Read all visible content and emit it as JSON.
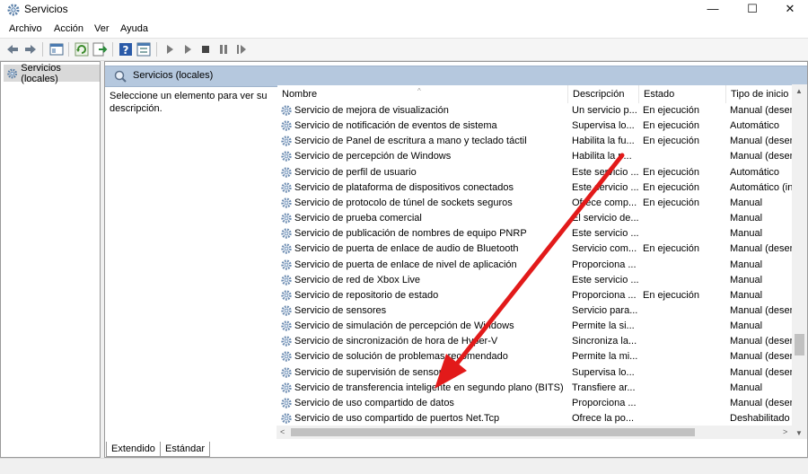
{
  "window": {
    "title": "Servicios"
  },
  "menu": [
    "Archivo",
    "Acción",
    "Ver",
    "Ayuda"
  ],
  "tree": {
    "root": "Servicios (locales)"
  },
  "pane": {
    "header": "Servicios (locales)",
    "description_prompt": "Seleccione un elemento para ver su descripción."
  },
  "columns": [
    "Nombre",
    "Descripción",
    "Estado",
    "Tipo de inicio"
  ],
  "rows": [
    {
      "name": "Servicio de mejora de visualización",
      "desc": "Un servicio p...",
      "state": "En ejecución",
      "start": "Manual (desen..."
    },
    {
      "name": "Servicio de notificación de eventos de sistema",
      "desc": "Supervisa lo...",
      "state": "En ejecución",
      "start": "Automático"
    },
    {
      "name": "Servicio de Panel de escritura a mano y teclado táctil",
      "desc": "Habilita la fu...",
      "state": "En ejecución",
      "start": "Manual (desen..."
    },
    {
      "name": "Servicio de percepción de Windows",
      "desc": "Habilita la p...",
      "state": "",
      "start": "Manual (desen..."
    },
    {
      "name": "Servicio de perfil de usuario",
      "desc": "Este servicio ...",
      "state": "En ejecución",
      "start": "Automático"
    },
    {
      "name": "Servicio de plataforma de dispositivos conectados",
      "desc": "Este servicio ...",
      "state": "En ejecución",
      "start": "Automático (in..."
    },
    {
      "name": "Servicio de protocolo de túnel de sockets seguros",
      "desc": "Ofrece comp...",
      "state": "En ejecución",
      "start": "Manual"
    },
    {
      "name": "Servicio de prueba comercial",
      "desc": "El servicio de...",
      "state": "",
      "start": "Manual"
    },
    {
      "name": "Servicio de publicación de nombres de equipo PNRP",
      "desc": "Este servicio ...",
      "state": "",
      "start": "Manual"
    },
    {
      "name": "Servicio de puerta de enlace de audio de Bluetooth",
      "desc": "Servicio com...",
      "state": "En ejecución",
      "start": "Manual (desen..."
    },
    {
      "name": "Servicio de puerta de enlace de nivel de aplicación",
      "desc": "Proporciona ...",
      "state": "",
      "start": "Manual"
    },
    {
      "name": "Servicio de red de Xbox Live",
      "desc": "Este servicio ...",
      "state": "",
      "start": "Manual"
    },
    {
      "name": "Servicio de repositorio de estado",
      "desc": "Proporciona ...",
      "state": "En ejecución",
      "start": "Manual"
    },
    {
      "name": "Servicio de sensores",
      "desc": "Servicio para...",
      "state": "",
      "start": "Manual (desen..."
    },
    {
      "name": "Servicio de simulación de percepción de Windows",
      "desc": "Permite la si...",
      "state": "",
      "start": "Manual"
    },
    {
      "name": "Servicio de sincronización de hora de Hyper-V",
      "desc": "Sincroniza la...",
      "state": "",
      "start": "Manual (desen..."
    },
    {
      "name": "Servicio de solución de problemas recomendado",
      "desc": "Permite la mi...",
      "state": "",
      "start": "Manual (desen..."
    },
    {
      "name": "Servicio de supervisión de sensores",
      "desc": "Supervisa lo...",
      "state": "",
      "start": "Manual (desen..."
    },
    {
      "name": "Servicio de transferencia inteligente en segundo plano (BITS)",
      "desc": "Transfiere ar...",
      "state": "",
      "start": "Manual"
    },
    {
      "name": "Servicio de uso compartido de datos",
      "desc": "Proporciona ...",
      "state": "",
      "start": "Manual (desen..."
    },
    {
      "name": "Servicio de uso compartido de puertos Net.Tcp",
      "desc": "Ofrece la po...",
      "state": "",
      "start": "Deshabilitado"
    }
  ],
  "tabs": [
    "Extendido",
    "Estándar"
  ],
  "colors": {
    "accent_header": "#b5c8de",
    "arrow": "#e21a1a"
  }
}
